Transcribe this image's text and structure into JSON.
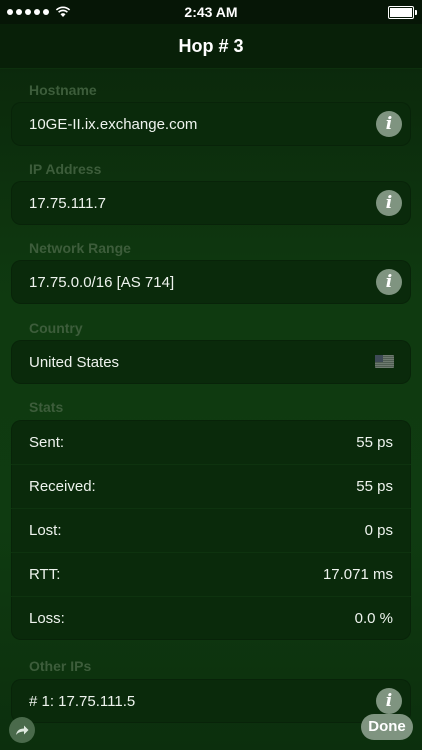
{
  "status_bar": {
    "time": "2:43 AM"
  },
  "nav": {
    "title": "Hop # 3"
  },
  "sections": {
    "hostname": {
      "header": "Hostname",
      "value": "10GE-II.ix.exchange.com"
    },
    "ip": {
      "header": "IP Address",
      "value": "17.75.111.7"
    },
    "range": {
      "header": "Network Range",
      "value": "17.75.0.0/16 [AS 714]"
    },
    "country": {
      "header": "Country",
      "value": "United States"
    },
    "stats": {
      "header": "Stats",
      "rows": [
        {
          "label": "Sent:",
          "value": "55 ps"
        },
        {
          "label": "Received:",
          "value": "55 ps"
        },
        {
          "label": "Lost:",
          "value": "0 ps"
        },
        {
          "label": "RTT:",
          "value": "17.071 ms"
        },
        {
          "label": "Loss:",
          "value": "0.0 %"
        }
      ]
    },
    "other_ips": {
      "header": "Other IPs",
      "value": "# 1: 17.75.111.5"
    }
  },
  "buttons": {
    "info_glyph": "i",
    "done_label": "Done"
  },
  "icons": {
    "share": "share-arrow-icon",
    "info": "info-icon",
    "flag": "us-flag-icon"
  },
  "colors": {
    "background": "#0f3a10",
    "card": "#0a2a0b",
    "header_text": "#3d5d3b",
    "button": "#7f9480"
  }
}
